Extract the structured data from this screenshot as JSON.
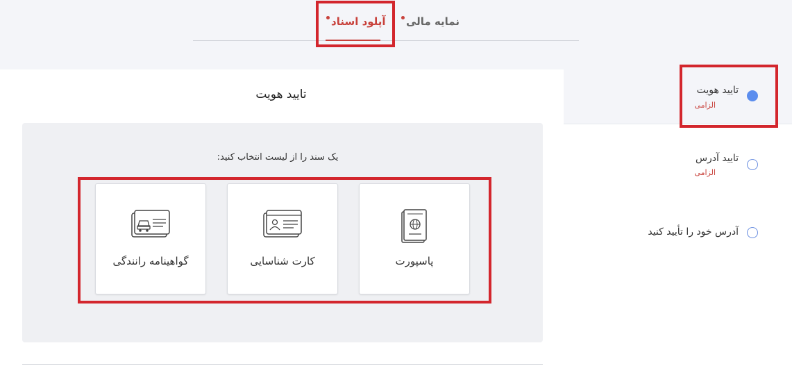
{
  "tabs": [
    {
      "label": "آپلود اسناد",
      "active": true
    },
    {
      "label": "نمایه مالی",
      "active": false
    }
  ],
  "main": {
    "title": "تایید هویت",
    "instruction": "یک سند را از لیست انتخاب کنید:",
    "documents": [
      {
        "label": "پاسپورت",
        "icon": "passport-icon"
      },
      {
        "label": "کارت شناسایی",
        "icon": "id-card-icon"
      },
      {
        "label": "گواهینامه رانندگی",
        "icon": "driver-license-icon"
      }
    ]
  },
  "steps": [
    {
      "title": "تایید هویت",
      "sub": "الزامی",
      "state": "active"
    },
    {
      "title": "تایید آدرس",
      "sub": "الزامی",
      "state": "pending"
    },
    {
      "title": "آدرس خود را تأیید کنید",
      "sub": "",
      "state": "pending"
    }
  ],
  "colors": {
    "accent": "#c8413b",
    "highlight": "#d3262d",
    "radio": "#5b8dee",
    "background": "#f4f5f9"
  }
}
